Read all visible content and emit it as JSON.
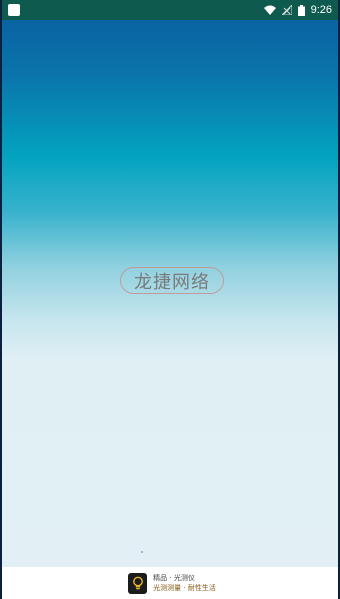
{
  "status_bar": {
    "time": "9:26",
    "icons": [
      "notification-square-icon",
      "wifi-icon",
      "no-signal-icon",
      "battery-icon"
    ]
  },
  "splash": {
    "brand_text": "龙捷网络",
    "colors": {
      "top": "#0a63a1",
      "mid": "#03a3c0",
      "bottom": "#e2f0f5",
      "badge_border": "#c39a98",
      "badge_text": "#7a7a7a"
    }
  },
  "footer": {
    "title": "精品 · 光测仪",
    "subtitle": "光测测量 · 耐性生活",
    "logo_icon": "lightbulb-icon"
  }
}
